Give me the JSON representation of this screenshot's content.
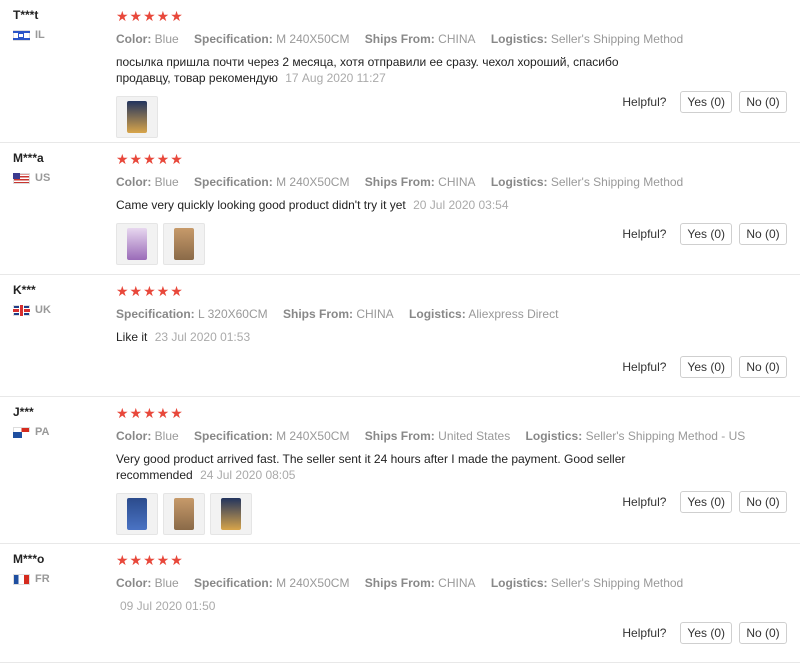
{
  "labels": {
    "color": "Color:",
    "specification": "Specification:",
    "ships_from": "Ships From:",
    "logistics": "Logistics:",
    "helpful": "Helpful?",
    "yes": "Yes (0)",
    "no": "No (0)"
  },
  "colors": {
    "star": "#e8483b",
    "accent_text": "#999999"
  },
  "reviews": [
    {
      "user": "T***t",
      "country": "IL",
      "stars": "★★★★★",
      "color": "Blue",
      "specification": "M 240X50CM",
      "ships_from": "CHINA",
      "logistics": "Seller's Shipping Method",
      "text": "посылка пришла почти через 2 месяца, хотя отправили ее сразу. чехол хороший, спасибо продавцу, товар рекомендую",
      "date": "17 Aug 2020 11:27",
      "photos": [
        "photo-icon"
      ]
    },
    {
      "user": "M***a",
      "country": "US",
      "stars": "★★★★★",
      "color": "Blue",
      "specification": "M 240X50CM",
      "ships_from": "CHINA",
      "logistics": "Seller's Shipping Method",
      "text": "Came very quickly looking good product didn't try it yet",
      "date": "20 Jul 2020 03:54",
      "photos": [
        "photo-icon",
        "photo-icon"
      ]
    },
    {
      "user": "K***",
      "country": "UK",
      "stars": "★★★★★",
      "color": "",
      "specification": "L 320X60CM",
      "ships_from": "CHINA",
      "logistics": "Aliexpress Direct",
      "text": "Like it",
      "date": "23 Jul 2020 01:53",
      "photos": []
    },
    {
      "user": "J***",
      "country": "PA",
      "stars": "★★★★★",
      "color": "Blue",
      "specification": "M 240X50CM",
      "ships_from": "United States",
      "logistics": "Seller's Shipping Method - US",
      "text": "Very good product arrived fast. The seller sent it 24 hours after I made the payment. Good seller recommended",
      "date": "24 Jul 2020 08:05",
      "photos": [
        "photo-icon",
        "photo-icon",
        "photo-icon"
      ]
    },
    {
      "user": "M***o",
      "country": "FR",
      "stars": "★★★★★",
      "color": "Blue",
      "specification": "M 240X50CM",
      "ships_from": "CHINA",
      "logistics": "Seller's Shipping Method",
      "text": "",
      "date": "09 Jul 2020 01:50",
      "photos": []
    }
  ]
}
